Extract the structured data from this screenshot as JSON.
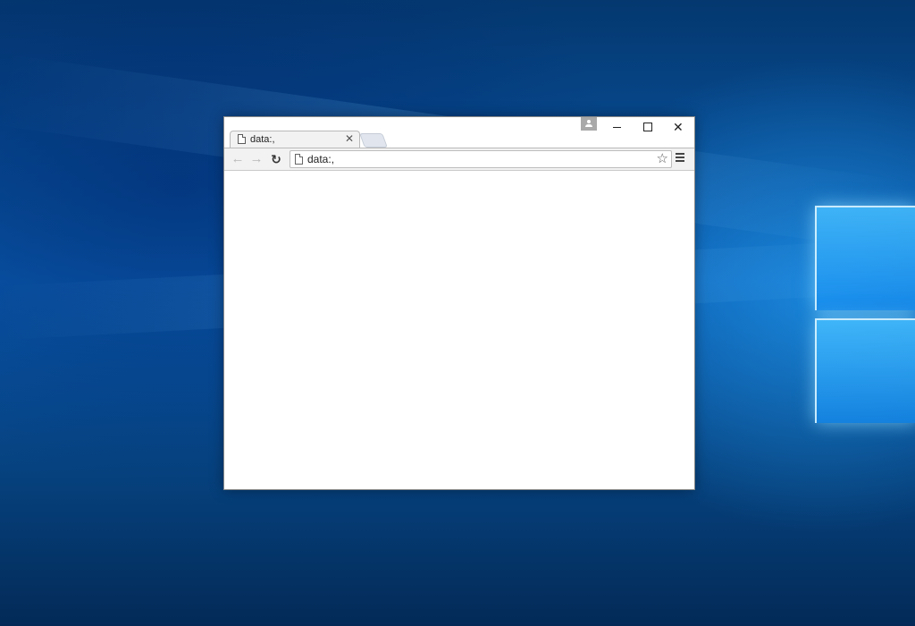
{
  "browser": {
    "tab": {
      "title": "data:,",
      "close_glyph": "✕",
      "icon": "page-icon"
    },
    "window_controls": {
      "minimize": "minimize-icon",
      "maximize": "maximize-icon",
      "close_glyph": "✕"
    },
    "toolbar": {
      "back_glyph": "←",
      "forward_glyph": "→",
      "reload_glyph": "↻",
      "address": "data:,",
      "bookmark_glyph": "☆"
    }
  },
  "colors": {
    "desktop_blue": "#0a5bb0",
    "window_bg": "#ffffff",
    "toolbar_bg": "#f2f2f2"
  }
}
